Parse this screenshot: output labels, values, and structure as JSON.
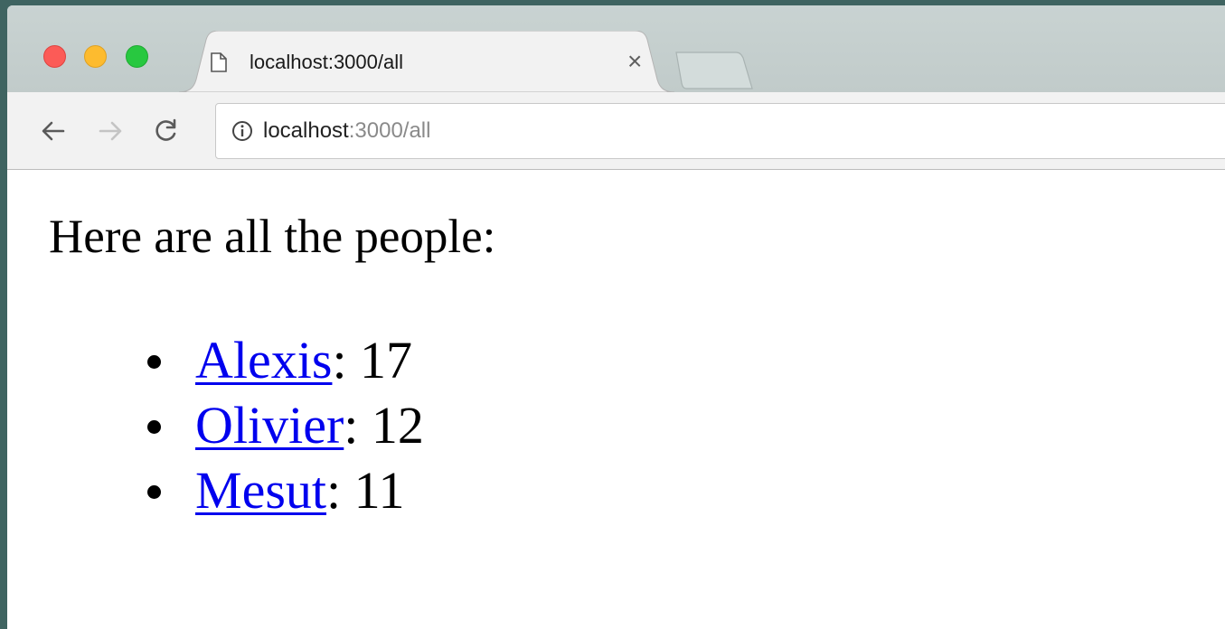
{
  "browser": {
    "tab": {
      "title": "localhost:3000/all",
      "close_glyph": "×"
    },
    "address": {
      "host": "localhost",
      "rest": ":3000/all"
    },
    "icons": {
      "tab_page": "page-icon",
      "info": "info-icon",
      "back": "back-arrow-icon",
      "forward": "forward-arrow-icon",
      "reload": "reload-icon"
    }
  },
  "page": {
    "heading": "Here are all the people:",
    "people": [
      {
        "name": "Alexis",
        "value": ": 17"
      },
      {
        "name": "Olivier",
        "value": ": 12"
      },
      {
        "name": "Mesut",
        "value": ": 11"
      }
    ]
  }
}
